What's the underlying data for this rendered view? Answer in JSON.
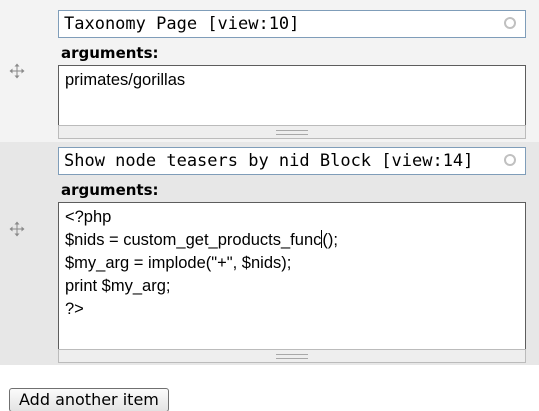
{
  "items": [
    {
      "view": "Taxonomy Page [view:10]",
      "arguments_label": "arguments:",
      "arguments_lines": [
        "primates/gorillas"
      ]
    },
    {
      "view": "Show node teasers by nid Block [view:14]",
      "arguments_label": "arguments:",
      "arguments_lines": [
        "<?php",
        "$nids = custom_get_products_func();",
        "$my_arg = implode(\"+\", $nids);",
        "print $my_arg;",
        "?>"
      ],
      "caret_after": "$nids = custom_get_products_func"
    }
  ],
  "add_button_label": "Add another item",
  "icons": {
    "drag": "drag-handle-icon",
    "autocomplete": "autocomplete-throbber-icon",
    "resize": "resize-grippie-icon"
  }
}
